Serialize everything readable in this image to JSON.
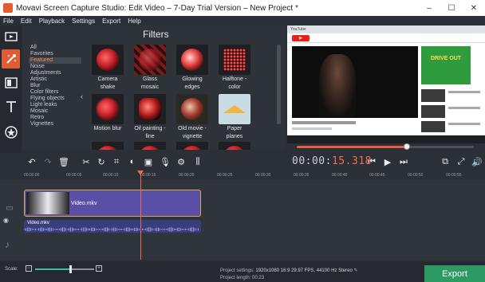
{
  "window": {
    "title": "Movavi Screen Capture Studio: Edit Video – 7-Day Trial Version – New Project *",
    "controls": [
      "–",
      "☐",
      "✕"
    ]
  },
  "menu": [
    "File",
    "Edit",
    "Playback",
    "Settings",
    "Export",
    "Help"
  ],
  "rail": {
    "items": [
      {
        "name": "import-icon"
      },
      {
        "name": "filters-icon"
      },
      {
        "name": "transitions-icon"
      },
      {
        "name": "titles-icon"
      },
      {
        "name": "stickers-icon"
      },
      {
        "name": "more-tools-icon"
      }
    ]
  },
  "filters": {
    "title": "Filters",
    "categories": [
      "All",
      "Favorites",
      "Featured",
      "Noise",
      "Adjustments",
      "Artistic",
      "Blur",
      "Color filters",
      "Flying objects",
      "Light leaks",
      "Mosaic",
      "Retro",
      "Vignettes"
    ],
    "selected_category": "Featured",
    "tiles": [
      {
        "label_1": "Camera",
        "label_2": "shake",
        "style": "camera"
      },
      {
        "label_1": "Glass",
        "label_2": "mosaic",
        "style": "mosaic"
      },
      {
        "label_1": "Glowing",
        "label_2": "edges",
        "style": "glow"
      },
      {
        "label_1": "Halftone -",
        "label_2": "color",
        "style": "halftone"
      },
      {
        "label_1": "Motion blur",
        "label_2": "",
        "style": "blur"
      },
      {
        "label_1": "Oil painting -",
        "label_2": "fine",
        "style": "oil"
      },
      {
        "label_1": "Old movie -",
        "label_2": "vignette",
        "style": "vintage"
      },
      {
        "label_1": "Paper",
        "label_2": "planes",
        "style": "planes"
      }
    ]
  },
  "preview": {
    "browser_tab": "YouTube",
    "ad_text": "DRIVE OUT",
    "seek_progress": 0.62
  },
  "toolbar": {
    "timecode_dim": "00:00:",
    "timecode_active": "15.318"
  },
  "ruler": {
    "ticks": [
      "00:00:00",
      "00:00:05",
      "00:00:10",
      "00:00:15",
      "00:00:20",
      "00:00:25",
      "00:00:30",
      "00:00:35",
      "00:00:40",
      "00:00:45",
      "00:00:50",
      "00:00:55"
    ]
  },
  "timeline": {
    "video_clip_label": "Video.mkv",
    "audio_clip_label": "Video.mkv"
  },
  "status": {
    "scale_label": "Scale:",
    "scale_value": 0.6,
    "project_settings_label": "Project settings:",
    "project_settings_value": "1920x1080 16:9 29.97 FPS, 44100 Hz Stereo",
    "project_length_label": "Project length:",
    "project_length_value": "00:23",
    "export_label": "Export"
  },
  "colors": {
    "accent": "#e25b35",
    "export": "#2c9b63",
    "clip": "#5a4fa6",
    "playhead": "#ef6a49"
  }
}
